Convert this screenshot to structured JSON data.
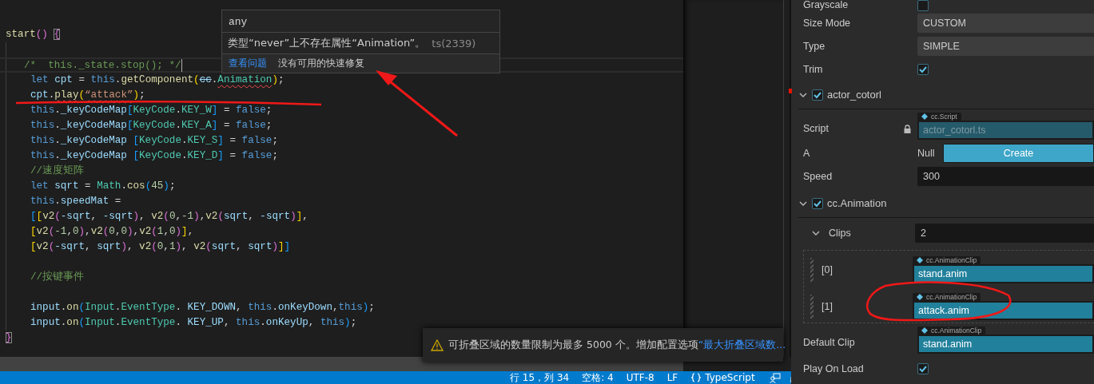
{
  "editor": {
    "lines": [
      {
        "kind": "code",
        "indented": false,
        "current": false,
        "tokens": [
          {
            "text": "start",
            "kind": "fn"
          },
          {
            "text": "() ",
            "kind": "b2"
          },
          {
            "text": "{",
            "kind": "b2",
            "bracket_match": true
          }
        ]
      },
      {
        "kind": "blank",
        "indented": true,
        "current": false
      },
      {
        "kind": "code",
        "indented": true,
        "current": true,
        "tokens": [
          {
            "text": "/*  this._state.stop(); */",
            "kind": "cmt"
          }
        ]
      },
      {
        "kind": "code",
        "indented": true,
        "current": false,
        "tokens": [
          {
            "text": "let ",
            "kind": "kw"
          },
          {
            "text": "cpt",
            "kind": "var"
          },
          {
            "text": " = ",
            "kind": "plain"
          },
          {
            "text": "this",
            "kind": "kw"
          },
          {
            "text": ".",
            "kind": "plain"
          },
          {
            "text": "getComponent",
            "kind": "fn"
          },
          {
            "text": "(",
            "kind": "b1"
          },
          {
            "text": "cc",
            "kind": "var",
            "deprecated": true
          },
          {
            "text": ".",
            "kind": "plain"
          },
          {
            "text": "Animation",
            "kind": "type",
            "error": true
          },
          {
            "text": ")",
            "kind": "b1"
          },
          {
            "text": ";",
            "kind": "plain"
          }
        ]
      },
      {
        "kind": "code",
        "indented": true,
        "current": false,
        "tokens": [
          {
            "text": "cpt",
            "kind": "var"
          },
          {
            "text": ".",
            "kind": "plain"
          },
          {
            "text": "play",
            "kind": "fn",
            "error": true
          },
          {
            "text": "(",
            "kind": "b1"
          },
          {
            "text": "“attack”",
            "kind": "str",
            "error": true
          },
          {
            "text": ")",
            "kind": "b1"
          },
          {
            "text": ";",
            "kind": "plain"
          }
        ]
      },
      {
        "kind": "code",
        "indented": true,
        "current": false,
        "tokens": [
          {
            "text": "this",
            "kind": "kw"
          },
          {
            "text": ".",
            "kind": "plain"
          },
          {
            "text": "_keyCodeMap",
            "kind": "var"
          },
          {
            "text": "[",
            "kind": "b3"
          },
          {
            "text": "KeyCode",
            "kind": "type"
          },
          {
            "text": ".",
            "kind": "plain"
          },
          {
            "text": "KEY_W",
            "kind": "type"
          },
          {
            "text": "]",
            "kind": "b3"
          },
          {
            "text": " = ",
            "kind": "plain"
          },
          {
            "text": "false",
            "kind": "kw"
          },
          {
            "text": ";",
            "kind": "plain"
          }
        ]
      },
      {
        "kind": "code",
        "indented": true,
        "current": false,
        "tokens": [
          {
            "text": "this",
            "kind": "kw"
          },
          {
            "text": ".",
            "kind": "plain"
          },
          {
            "text": "_keyCodeMap",
            "kind": "var"
          },
          {
            "text": "[",
            "kind": "b3"
          },
          {
            "text": "KeyCode",
            "kind": "type"
          },
          {
            "text": ".",
            "kind": "plain"
          },
          {
            "text": "KEY_A",
            "kind": "type"
          },
          {
            "text": "]",
            "kind": "b3"
          },
          {
            "text": " = ",
            "kind": "plain"
          },
          {
            "text": "false",
            "kind": "kw"
          },
          {
            "text": ";",
            "kind": "plain"
          }
        ]
      },
      {
        "kind": "code",
        "indented": true,
        "current": false,
        "tokens": [
          {
            "text": "this",
            "kind": "kw"
          },
          {
            "text": ".",
            "kind": "plain"
          },
          {
            "text": "_keyCodeMap",
            "kind": "var"
          },
          {
            "text": " [",
            "kind": "b3"
          },
          {
            "text": "KeyCode",
            "kind": "type"
          },
          {
            "text": ".",
            "kind": "plain"
          },
          {
            "text": "KEY_S",
            "kind": "type"
          },
          {
            "text": "]",
            "kind": "b3"
          },
          {
            "text": " = ",
            "kind": "plain"
          },
          {
            "text": "false",
            "kind": "kw"
          },
          {
            "text": ";",
            "kind": "plain"
          }
        ]
      },
      {
        "kind": "code",
        "indented": true,
        "current": false,
        "tokens": [
          {
            "text": "this",
            "kind": "kw"
          },
          {
            "text": ".",
            "kind": "plain"
          },
          {
            "text": "_keyCodeMap",
            "kind": "var"
          },
          {
            "text": " [",
            "kind": "b3"
          },
          {
            "text": "KeyCode",
            "kind": "type"
          },
          {
            "text": ".",
            "kind": "plain"
          },
          {
            "text": "KEY_D",
            "kind": "type"
          },
          {
            "text": "]",
            "kind": "b3"
          },
          {
            "text": " = ",
            "kind": "plain"
          },
          {
            "text": "false",
            "kind": "kw"
          },
          {
            "text": ";",
            "kind": "plain"
          }
        ]
      },
      {
        "kind": "code",
        "indented": true,
        "current": false,
        "tokens": [
          {
            "text": "//速度矩阵",
            "kind": "cmt"
          }
        ]
      },
      {
        "kind": "code",
        "indented": true,
        "current": false,
        "tokens": [
          {
            "text": "let ",
            "kind": "kw"
          },
          {
            "text": "sqrt",
            "kind": "var"
          },
          {
            "text": " = ",
            "kind": "plain"
          },
          {
            "text": "Math",
            "kind": "type"
          },
          {
            "text": ".",
            "kind": "plain"
          },
          {
            "text": "cos",
            "kind": "fn"
          },
          {
            "text": "(",
            "kind": "b3"
          },
          {
            "text": "45",
            "kind": "num"
          },
          {
            "text": ")",
            "kind": "b3"
          },
          {
            "text": ";",
            "kind": "plain"
          }
        ]
      },
      {
        "kind": "code",
        "indented": true,
        "current": false,
        "tokens": [
          {
            "text": "this",
            "kind": "kw"
          },
          {
            "text": ".",
            "kind": "plain"
          },
          {
            "text": "speedMat",
            "kind": "var"
          },
          {
            "text": " =",
            "kind": "plain"
          }
        ]
      },
      {
        "kind": "code",
        "indented": true,
        "current": false,
        "tokens": [
          {
            "text": "[",
            "kind": "b3"
          },
          {
            "text": "[",
            "kind": "b1"
          },
          {
            "text": "v2",
            "kind": "fn"
          },
          {
            "text": "(",
            "kind": "b2"
          },
          {
            "text": "-sqrt",
            "kind": "var"
          },
          {
            "text": ", ",
            "kind": "plain"
          },
          {
            "text": "-sqrt",
            "kind": "var"
          },
          {
            "text": ")",
            "kind": "b2"
          },
          {
            "text": ", ",
            "kind": "plain"
          },
          {
            "text": "v2",
            "kind": "fn"
          },
          {
            "text": "(",
            "kind": "b2"
          },
          {
            "text": "0",
            "kind": "num"
          },
          {
            "text": ",",
            "kind": "plain"
          },
          {
            "text": "-1",
            "kind": "num"
          },
          {
            "text": ")",
            "kind": "b2"
          },
          {
            "text": ",",
            "kind": "plain"
          },
          {
            "text": "v2",
            "kind": "fn"
          },
          {
            "text": "(",
            "kind": "b2"
          },
          {
            "text": "sqrt",
            "kind": "var"
          },
          {
            "text": ", ",
            "kind": "plain"
          },
          {
            "text": "-sqrt",
            "kind": "var"
          },
          {
            "text": ")",
            "kind": "b2"
          },
          {
            "text": "]",
            "kind": "b1"
          },
          {
            "text": ",",
            "kind": "plain"
          }
        ]
      },
      {
        "kind": "code",
        "indented": true,
        "current": false,
        "tokens": [
          {
            "text": "[",
            "kind": "b1"
          },
          {
            "text": "v2",
            "kind": "fn"
          },
          {
            "text": "(",
            "kind": "b2"
          },
          {
            "text": "-1",
            "kind": "num"
          },
          {
            "text": ",",
            "kind": "plain"
          },
          {
            "text": "0",
            "kind": "num"
          },
          {
            "text": ")",
            "kind": "b2"
          },
          {
            "text": ",",
            "kind": "plain"
          },
          {
            "text": "v2",
            "kind": "fn"
          },
          {
            "text": "(",
            "kind": "b2"
          },
          {
            "text": "0",
            "kind": "num"
          },
          {
            "text": ",",
            "kind": "plain"
          },
          {
            "text": "0",
            "kind": "num"
          },
          {
            "text": ")",
            "kind": "b2"
          },
          {
            "text": ",",
            "kind": "plain"
          },
          {
            "text": "v2",
            "kind": "fn"
          },
          {
            "text": "(",
            "kind": "b2"
          },
          {
            "text": "1",
            "kind": "num"
          },
          {
            "text": ",",
            "kind": "plain"
          },
          {
            "text": "0",
            "kind": "num"
          },
          {
            "text": ")",
            "kind": "b2"
          },
          {
            "text": "]",
            "kind": "b1"
          },
          {
            "text": ",",
            "kind": "plain"
          }
        ]
      },
      {
        "kind": "code",
        "indented": true,
        "current": false,
        "tokens": [
          {
            "text": "[",
            "kind": "b1"
          },
          {
            "text": "v2",
            "kind": "fn"
          },
          {
            "text": "(",
            "kind": "b2"
          },
          {
            "text": "-sqrt",
            "kind": "var"
          },
          {
            "text": ", ",
            "kind": "plain"
          },
          {
            "text": "sqrt",
            "kind": "var"
          },
          {
            "text": ")",
            "kind": "b2"
          },
          {
            "text": ", ",
            "kind": "plain"
          },
          {
            "text": "v2",
            "kind": "fn"
          },
          {
            "text": "(",
            "kind": "b2"
          },
          {
            "text": "0",
            "kind": "num"
          },
          {
            "text": ",",
            "kind": "plain"
          },
          {
            "text": "1",
            "kind": "num"
          },
          {
            "text": ")",
            "kind": "b2"
          },
          {
            "text": ", ",
            "kind": "plain"
          },
          {
            "text": "v2",
            "kind": "fn"
          },
          {
            "text": "(",
            "kind": "b2"
          },
          {
            "text": "sqrt",
            "kind": "var"
          },
          {
            "text": ", ",
            "kind": "plain"
          },
          {
            "text": "sqrt",
            "kind": "var"
          },
          {
            "text": ")",
            "kind": "b2"
          },
          {
            "text": "]",
            "kind": "b1"
          },
          {
            "text": "]",
            "kind": "b3"
          }
        ]
      },
      {
        "kind": "blank",
        "indented": true,
        "current": false
      },
      {
        "kind": "code",
        "indented": true,
        "current": false,
        "tokens": [
          {
            "text": "//按键事件",
            "kind": "cmt"
          }
        ]
      },
      {
        "kind": "blank",
        "indented": true,
        "current": false
      },
      {
        "kind": "code",
        "indented": true,
        "current": false,
        "tokens": [
          {
            "text": "input",
            "kind": "var"
          },
          {
            "text": ".",
            "kind": "plain"
          },
          {
            "text": "on",
            "kind": "fn"
          },
          {
            "text": "(",
            "kind": "b3"
          },
          {
            "text": "Input",
            "kind": "type"
          },
          {
            "text": ".",
            "kind": "plain"
          },
          {
            "text": "EventType",
            "kind": "type"
          },
          {
            "text": ". ",
            "kind": "plain"
          },
          {
            "text": "KEY_DOWN",
            "kind": "var"
          },
          {
            "text": ", ",
            "kind": "plain"
          },
          {
            "text": "this",
            "kind": "kw"
          },
          {
            "text": ".",
            "kind": "plain"
          },
          {
            "text": "onKeyDown",
            "kind": "var"
          },
          {
            "text": ",",
            "kind": "plain"
          },
          {
            "text": "this",
            "kind": "kw"
          },
          {
            "text": ")",
            "kind": "b3"
          },
          {
            "text": ";",
            "kind": "plain"
          }
        ]
      },
      {
        "kind": "code",
        "indented": true,
        "current": false,
        "tokens": [
          {
            "text": "input",
            "kind": "var"
          },
          {
            "text": ".",
            "kind": "plain"
          },
          {
            "text": "on",
            "kind": "fn"
          },
          {
            "text": "(",
            "kind": "b3"
          },
          {
            "text": "Input",
            "kind": "type"
          },
          {
            "text": ".",
            "kind": "plain"
          },
          {
            "text": "EventType",
            "kind": "type"
          },
          {
            "text": ". ",
            "kind": "plain"
          },
          {
            "text": "KEY_UP",
            "kind": "var"
          },
          {
            "text": ", ",
            "kind": "plain"
          },
          {
            "text": "this",
            "kind": "kw"
          },
          {
            "text": ".",
            "kind": "plain"
          },
          {
            "text": "onKeyUp",
            "kind": "var"
          },
          {
            "text": ", ",
            "kind": "plain"
          },
          {
            "text": "this",
            "kind": "kw"
          },
          {
            "text": ")",
            "kind": "b3"
          },
          {
            "text": ";",
            "kind": "plain"
          }
        ]
      },
      {
        "kind": "code",
        "indented": false,
        "current": false,
        "tokens": [
          {
            "text": "}",
            "kind": "b2",
            "bracket_match": true
          }
        ]
      }
    ]
  },
  "hover": {
    "type": "any",
    "message": "类型“never”上不存在属性“Animation”。",
    "code": "ts(2339)",
    "link": "查看问题",
    "note": "没有可用的快速修复"
  },
  "notification": {
    "text": "可折叠区域的数量限制为最多 5000 个。增加配置选项",
    "link": "“最大折叠区域数..."
  },
  "status_bar": {
    "position": "行 15，列 34",
    "indent": "空格: 4",
    "encoding": "UTF-8",
    "eol": "LF",
    "language": "TypeScript"
  },
  "inspector": {
    "rows": [
      {
        "kind": "checkbox",
        "label": "Grayscale",
        "checked": false
      },
      {
        "kind": "select",
        "label": "Size Mode",
        "value": "CUSTOM"
      },
      {
        "kind": "select",
        "label": "Type",
        "value": "SIMPLE"
      },
      {
        "kind": "checkbox",
        "label": "Trim",
        "checked": true
      },
      {
        "kind": "section",
        "label": "actor_cotorl",
        "checked": true,
        "expanded": true
      },
      {
        "kind": "asset",
        "label": "Script",
        "locked": true,
        "tag": "cc.Script",
        "value": "actor_cotorl.ts"
      },
      {
        "kind": "node",
        "label": "A",
        "value": "Null",
        "button": "Create"
      },
      {
        "kind": "number",
        "label": "Speed",
        "value": "300"
      },
      {
        "kind": "section",
        "label": "cc.Animation",
        "checked": true,
        "expanded": true
      },
      {
        "kind": "array",
        "label": "Clips",
        "expanded": true,
        "value": "2",
        "items": [
          {
            "label": "[0]",
            "tag": "cc.AnimationClip",
            "value": "stand.anim"
          },
          {
            "label": "[1]",
            "tag": "cc.AnimationClip",
            "value": "attack.anim"
          }
        ]
      },
      {
        "kind": "asset",
        "label": "Default Clip",
        "locked": false,
        "tag": "cc.AnimationClip",
        "value": "stand.anim"
      },
      {
        "kind": "checkbox",
        "label": "Play On Load",
        "checked": true
      }
    ]
  }
}
